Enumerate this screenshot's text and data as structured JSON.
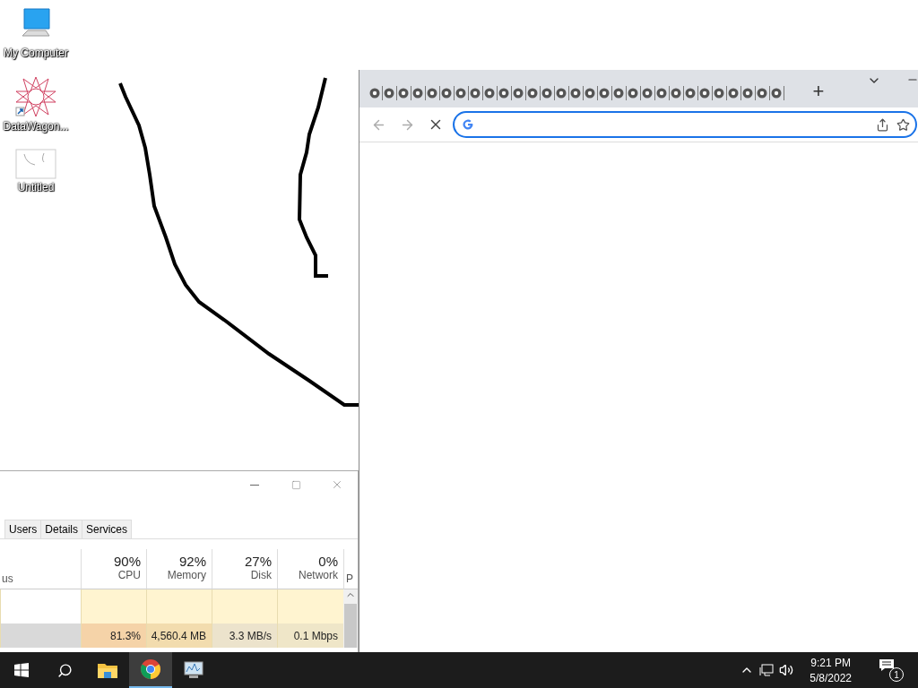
{
  "desktop_icons": [
    {
      "kind": "computer",
      "label": "My Computer"
    },
    {
      "kind": "app",
      "label": "DataWagon..."
    },
    {
      "kind": "document",
      "label": "Untitled"
    }
  ],
  "task_manager": {
    "tabs": [
      {
        "label": "Users",
        "selected": false
      },
      {
        "label": "Details",
        "selected": false
      },
      {
        "label": "Services",
        "selected": false
      }
    ],
    "first_column": "us",
    "columns": [
      {
        "percent": "90%",
        "label": "CPU"
      },
      {
        "percent": "92%",
        "label": "Memory"
      },
      {
        "percent": "27%",
        "label": "Disk"
      },
      {
        "percent": "0%",
        "label": "Network"
      }
    ],
    "last_column": "P",
    "rows": [
      {
        "selected": true,
        "cells": [
          "81.3%",
          "4,560.4 MB",
          "3.3 MB/s",
          "0.1 Mbps"
        ]
      }
    ]
  },
  "browser": {
    "new_tab": "+"
  },
  "taskbar": {
    "apps": [
      {
        "kind": "folder",
        "selected": false
      },
      {
        "kind": "chrome",
        "selected": true
      },
      {
        "kind": "monitor",
        "selected": false
      }
    ],
    "time": "9:21 PM",
    "date": "5/8/2022",
    "notifications": "1"
  }
}
